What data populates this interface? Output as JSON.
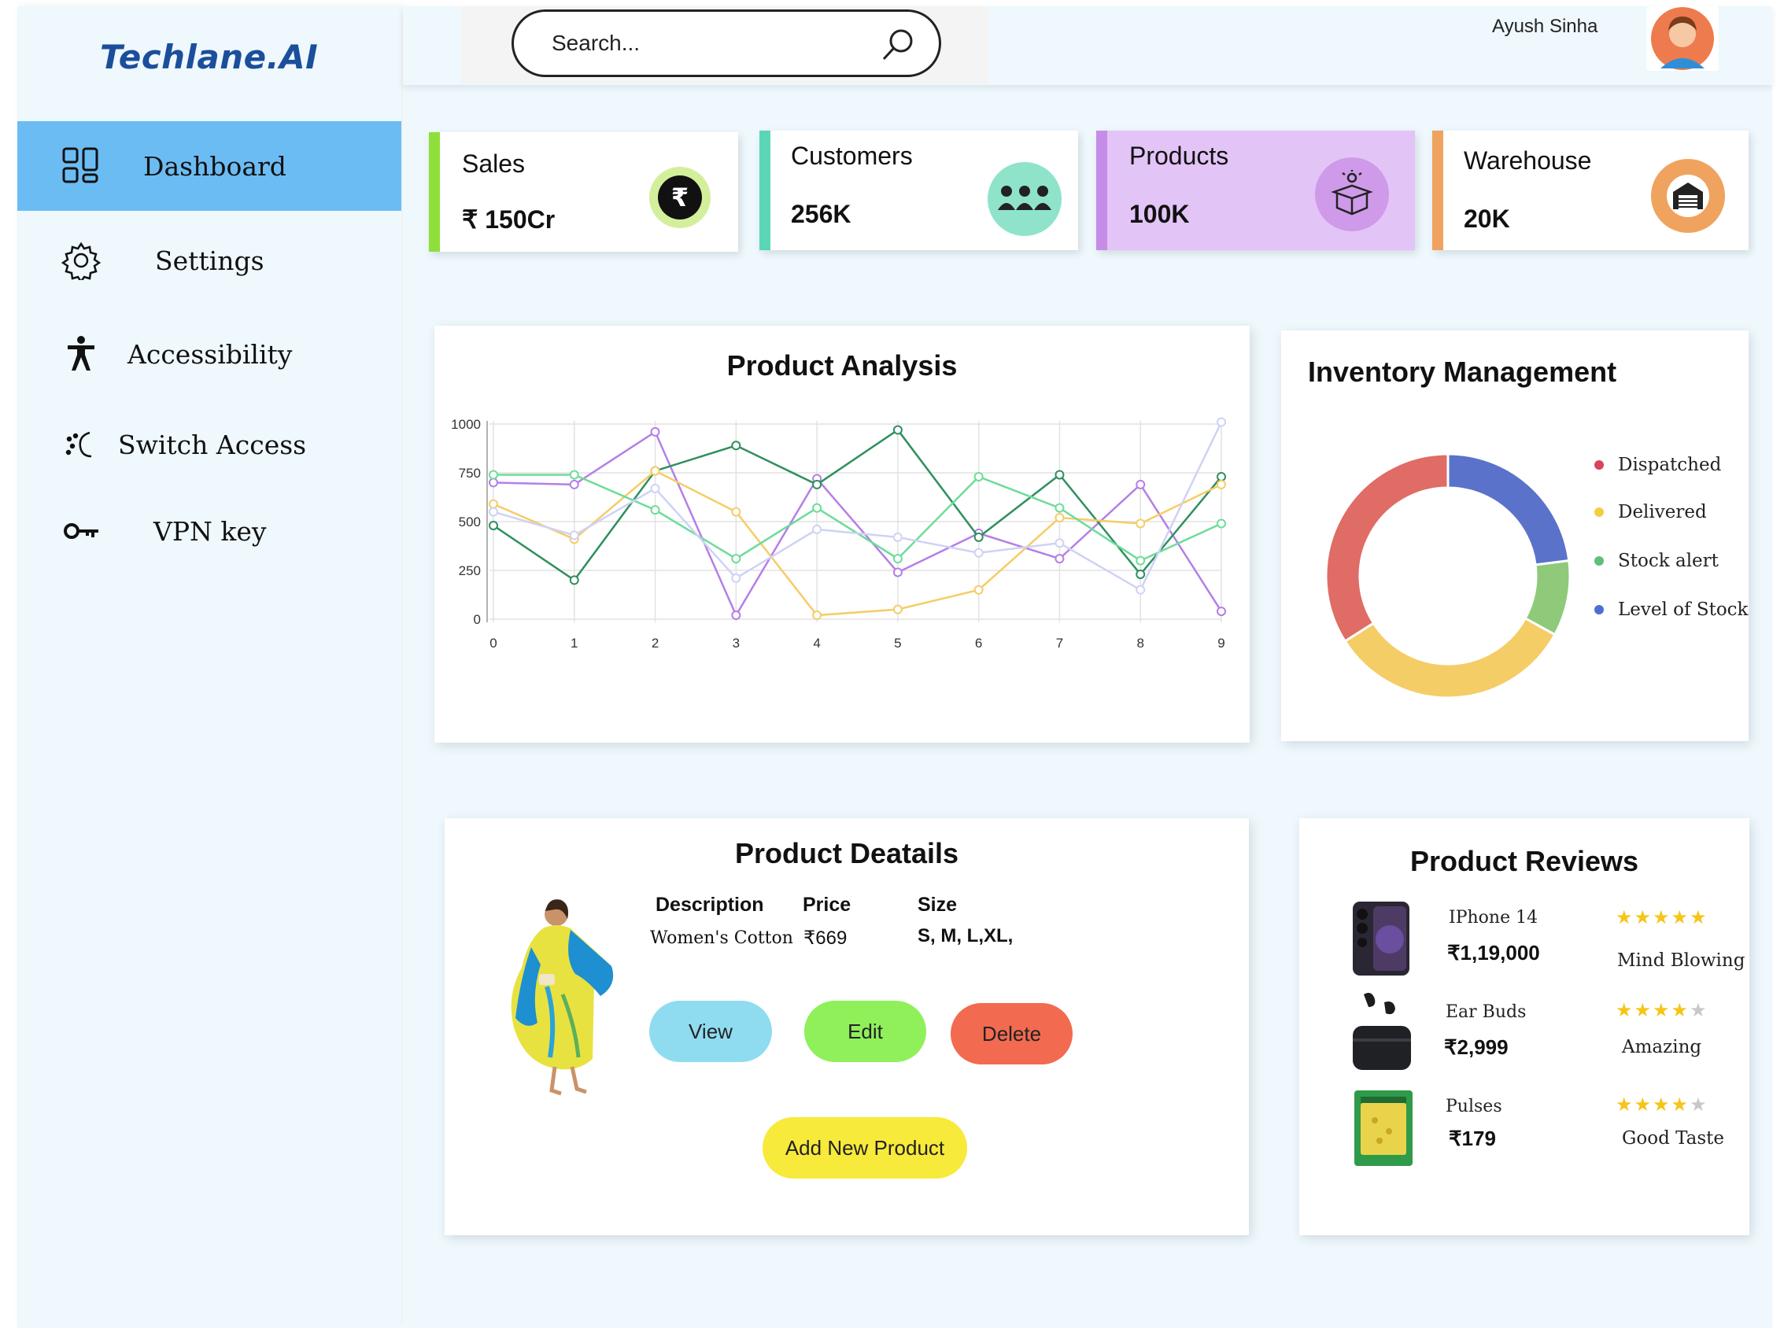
{
  "brand": "Techlane.AI",
  "sidebar": {
    "items": [
      {
        "label": "Dashboard",
        "icon": "dashboard-grid-icon",
        "active": true
      },
      {
        "label": "Settings",
        "icon": "gear-icon"
      },
      {
        "label": "Accessibility",
        "icon": "accessibility-person-icon"
      },
      {
        "label": "Switch Access",
        "icon": "switch-access-icon"
      },
      {
        "label": "VPN key",
        "icon": "key-icon"
      }
    ]
  },
  "header": {
    "search_placeholder": "Search...",
    "user_name": "Ayush Sinha"
  },
  "stats": [
    {
      "title": "Sales",
      "value": "₹ 150Cr",
      "icon": "rupee-coin-icon",
      "accent": "#8fdf3a"
    },
    {
      "title": "Customers",
      "value": "256K",
      "icon": "customers-group-icon",
      "accent": "#5ad6b5"
    },
    {
      "title": "Products",
      "value": "100K",
      "icon": "product-box-icon",
      "accent": "#c58de8"
    },
    {
      "title": "Warehouse",
      "value": "20K",
      "icon": "warehouse-icon",
      "accent": "#f0a35e"
    }
  ],
  "product_analysis": {
    "title": "Product Analysis",
    "chart_data": {
      "type": "line",
      "x": [
        0,
        1,
        2,
        3,
        4,
        5,
        6,
        7,
        8,
        9
      ],
      "ylim": [
        0,
        1000
      ],
      "yticks": [
        0,
        250,
        500,
        750,
        1000
      ],
      "series": [
        {
          "color": "#b57ee8",
          "values": [
            700,
            690,
            960,
            20,
            720,
            240,
            440,
            310,
            690,
            40
          ]
        },
        {
          "color": "#2f8f5e",
          "values": [
            480,
            200,
            760,
            890,
            690,
            970,
            420,
            740,
            230,
            730
          ]
        },
        {
          "color": "#f5cd66",
          "values": [
            590,
            410,
            760,
            550,
            20,
            50,
            150,
            520,
            490,
            690
          ]
        },
        {
          "color": "#6edc9a",
          "values": [
            740,
            740,
            560,
            310,
            570,
            310,
            730,
            570,
            300,
            490
          ]
        },
        {
          "color": "#cfd2f5",
          "values": [
            550,
            430,
            670,
            210,
            460,
            420,
            340,
            390,
            150,
            1010
          ]
        }
      ]
    }
  },
  "inventory": {
    "title": "Inventory Management",
    "chart_data": {
      "type": "pie",
      "donut": true,
      "categories": [
        "Dispatched",
        "Delivered",
        "Stock alert",
        "Level of Stock"
      ],
      "values": [
        34,
        33,
        10,
        23
      ],
      "colors": [
        "#e06c66",
        "#f4cd66",
        "#8fc97a",
        "#5a72c9"
      ],
      "legend_dot_colors": [
        "#d9435b",
        "#f4cd44",
        "#5fbf7a",
        "#4b6fd1"
      ]
    }
  },
  "product_details": {
    "title": "Product Deatails",
    "columns": {
      "description": "Description",
      "price": "Price",
      "size": "Size"
    },
    "values": {
      "description": "Women's Cotton",
      "price": "₹669",
      "size": "S, M, L,XL,"
    },
    "buttons": {
      "view": "View",
      "edit": "Edit",
      "delete": "Delete",
      "add": "Add New Product"
    }
  },
  "reviews": {
    "title": "Product Reviews",
    "items": [
      {
        "name": "IPhone 14",
        "price": "₹1,19,000",
        "rating": 5,
        "comment": "Mind Blowing"
      },
      {
        "name": "Ear Buds",
        "price": "₹2,999",
        "rating": 4,
        "comment": "Amazing"
      },
      {
        "name": "Pulses",
        "price": "₹179",
        "rating": 4,
        "comment": "Good Taste"
      }
    ]
  }
}
